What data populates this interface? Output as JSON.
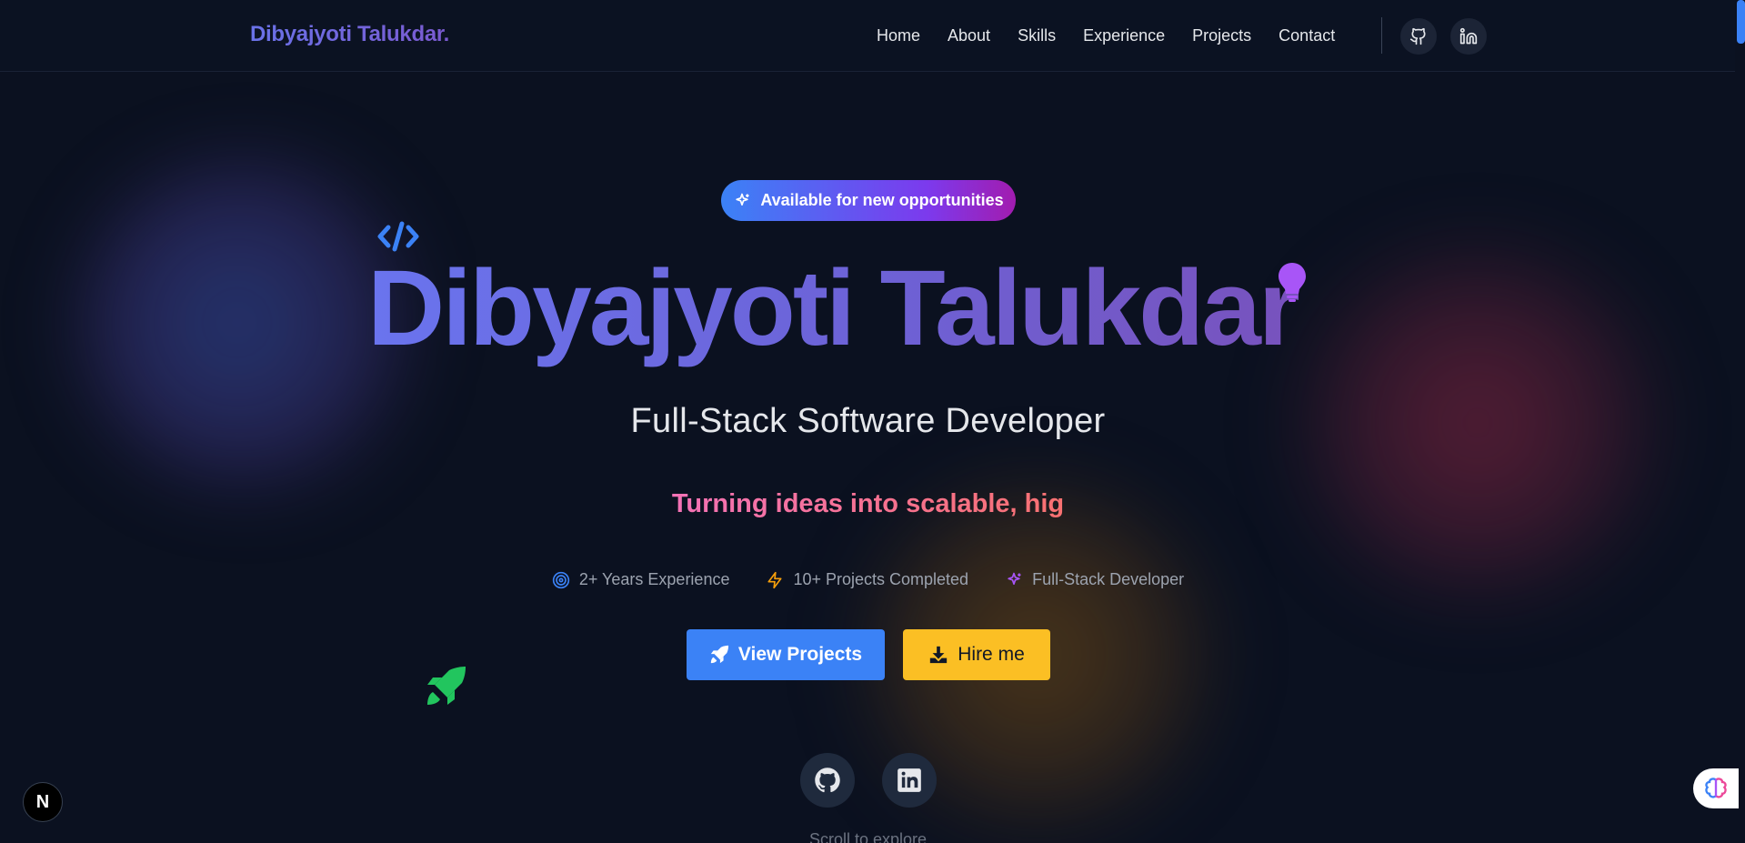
{
  "navbar": {
    "brand": "Dibyajyoti Talukdar.",
    "links": [
      {
        "label": "Home"
      },
      {
        "label": "About"
      },
      {
        "label": "Skills"
      },
      {
        "label": "Experience"
      },
      {
        "label": "Projects"
      },
      {
        "label": "Contact"
      }
    ],
    "icons": [
      "github-icon",
      "linkedin-icon"
    ]
  },
  "hero": {
    "badge": "Available for new opportunities",
    "name": "Dibyajyoti Talukdar",
    "role": "Full-Stack Software Developer",
    "tagline": "Turning ideas into scalable, hig",
    "stats": [
      {
        "label": "2+ Years Experience",
        "icon": "target-icon",
        "color": "#3b82f6"
      },
      {
        "label": "10+ Projects Completed",
        "icon": "lightning-icon",
        "color": "#f59e0b"
      },
      {
        "label": "Full-Stack Developer",
        "icon": "sparkles-icon",
        "color": "#a855f7"
      }
    ],
    "primary_button": "View Projects",
    "secondary_button": "Hire me",
    "scroll_hint": "Scroll to explore"
  },
  "floating_badge": "N",
  "colors": {
    "background": "#0b1120",
    "primary": "#3b82f6",
    "accent": "#fbbf24",
    "rocket": "#22c55e",
    "bulb": "#a855f7"
  }
}
